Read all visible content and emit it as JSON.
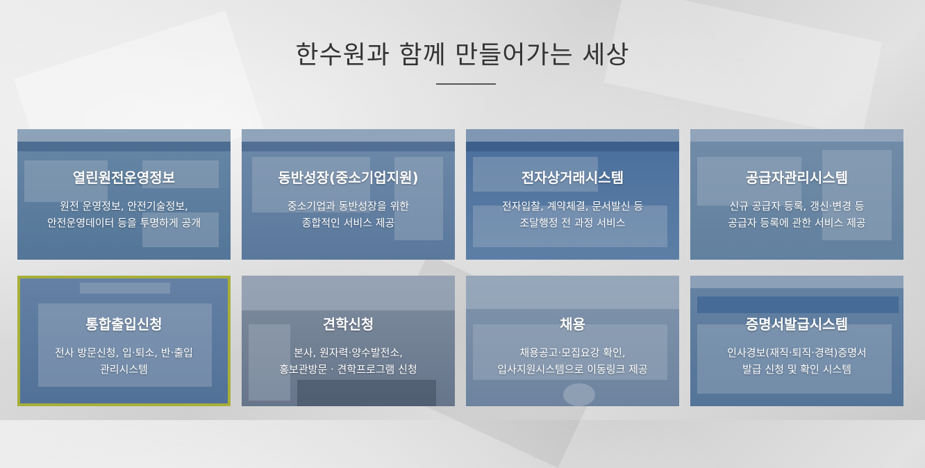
{
  "page": {
    "title": "한수원과 함께 만들어가는 세상"
  },
  "cards": [
    {
      "title": "열린원전운영정보",
      "lines": [
        "원전 운영정보, 안전기술정보,",
        "안전운영데이터 등을 투명하게 공개"
      ]
    },
    {
      "title": "동반성장(중소기업지원)",
      "lines": [
        "중소기업과 동반성장을 위한",
        "종합적인 서비스 제공"
      ]
    },
    {
      "title": "전자상거래시스템",
      "lines": [
        "전자입찰, 계약체결, 문서발신 등",
        "조달행정 전 과정 서비스"
      ]
    },
    {
      "title": "공급자관리시스템",
      "lines": [
        "신규 공급자 등록, 갱신·변경 등",
        "공급자 등록에 관한 서비스 제공"
      ]
    },
    {
      "title": "통합출입신청",
      "lines": [
        "전사 방문신청, 입·퇴소, 반·출입",
        "관리시스템"
      ]
    },
    {
      "title": "견학신청",
      "lines": [
        "본사, 원자력·양수발전소,",
        "홍보관방문 · 견학프로그램 신청"
      ]
    },
    {
      "title": "채용",
      "lines": [
        "채용공고·모집요강 확인,",
        "입사지원시스템으로 이동링크 제공"
      ]
    },
    {
      "title": "증명서발급시스템",
      "lines": [
        "인사경보(재직·퇴직·경력)증명서",
        "발급 신청 및 확인 시스템"
      ]
    }
  ]
}
